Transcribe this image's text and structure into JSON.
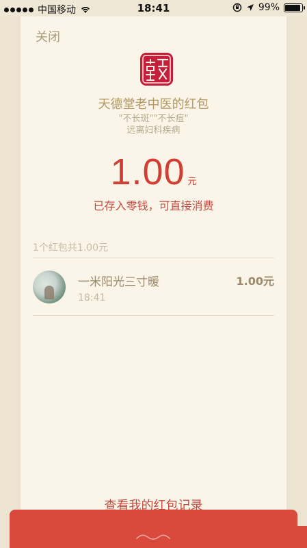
{
  "status_bar": {
    "carrier": "中国移动",
    "time": "18:41",
    "battery": "99%",
    "battery_level": 0.99
  },
  "packet": {
    "close_label": "关闭",
    "logo_text": "天德堂",
    "sender": "天德堂老中医的红包",
    "slogan_line1": "\"不长斑\"\"不长痘\"",
    "slogan_line2": "远离妇科疾病",
    "amount": "1.00",
    "unit": "元",
    "deposit_note": "已存入零钱，可直接消费"
  },
  "records": {
    "summary": "1个红包共1.00元",
    "items": [
      {
        "name": "一米阳光三寸暖",
        "time": "18:41",
        "amount": "1.00元"
      }
    ]
  },
  "footer": {
    "history_label": "查看我的红包记录"
  },
  "colors": {
    "accent_red": "#cf3f34",
    "envelope_red": "#d94a3d",
    "card_bg": "#faf5e8",
    "gold_text": "#b39862"
  }
}
